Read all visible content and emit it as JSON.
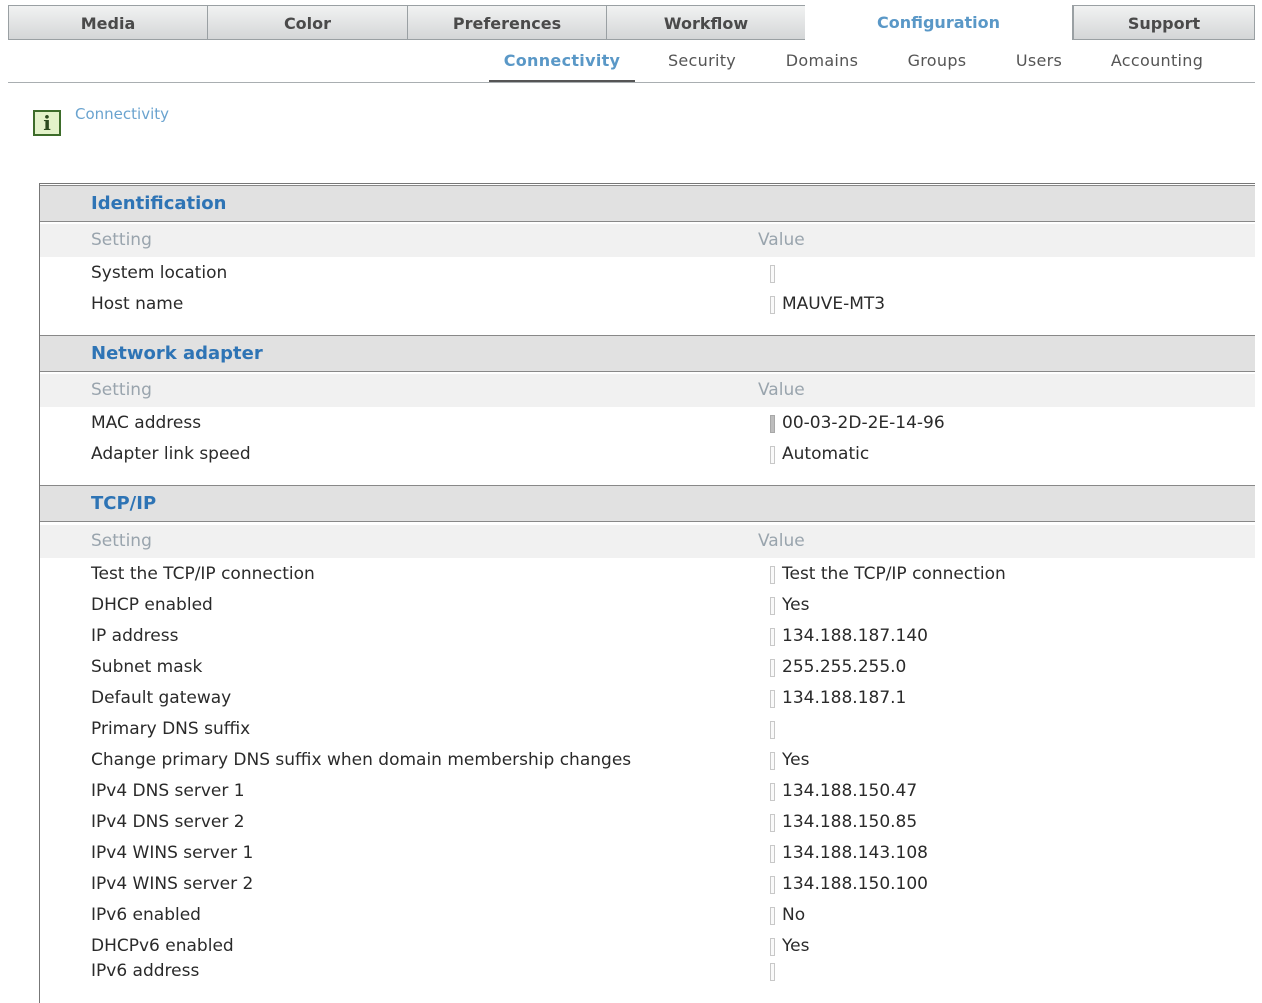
{
  "top_tabs": [
    {
      "label": "Media"
    },
    {
      "label": "Color"
    },
    {
      "label": "Preferences"
    },
    {
      "label": "Workflow"
    },
    {
      "label": "Configuration"
    },
    {
      "label": "Support"
    }
  ],
  "sub_tabs": [
    {
      "label": "Connectivity"
    },
    {
      "label": "Security"
    },
    {
      "label": "Domains"
    },
    {
      "label": "Groups"
    },
    {
      "label": "Users"
    },
    {
      "label": "Accounting"
    }
  ],
  "breadcrumb": {
    "icon": "info-icon",
    "icon_glyph": "i",
    "text": "Connectivity"
  },
  "columns": {
    "setting": "Setting",
    "value": "Value"
  },
  "sections": [
    {
      "title": "Identification",
      "rows": [
        {
          "label": "System location",
          "value": ""
        },
        {
          "label": "Host name",
          "value": "MAUVE-MT3"
        }
      ]
    },
    {
      "title": "Network adapter",
      "rows": [
        {
          "label": "MAC address",
          "value": "00-03-2D-2E-14-96"
        },
        {
          "label": "Adapter link speed",
          "value": "Automatic"
        }
      ]
    },
    {
      "title": "TCP/IP",
      "rows": [
        {
          "label": "Test the TCP/IP connection",
          "value": "Test the TCP/IP connection"
        },
        {
          "label": "DHCP enabled",
          "value": "Yes"
        },
        {
          "label": "IP address",
          "value": "134.188.187.140"
        },
        {
          "label": "Subnet mask",
          "value": "255.255.255.0"
        },
        {
          "label": "Default gateway",
          "value": "134.188.187.1"
        },
        {
          "label": "Primary DNS suffix",
          "value": ""
        },
        {
          "label": "Change primary DNS suffix when domain membership changes",
          "value": "Yes"
        },
        {
          "label": "IPv4 DNS server 1",
          "value": "134.188.150.47"
        },
        {
          "label": "IPv4 DNS server 2",
          "value": "134.188.150.85"
        },
        {
          "label": "IPv4 WINS server 1",
          "value": "134.188.143.108"
        },
        {
          "label": "IPv4 WINS server 2",
          "value": "134.188.150.100"
        },
        {
          "label": "IPv6 enabled",
          "value": "No"
        },
        {
          "label": "DHCPv6 enabled",
          "value": "Yes"
        },
        {
          "label": "IPv6 address",
          "value": ""
        }
      ]
    }
  ]
}
